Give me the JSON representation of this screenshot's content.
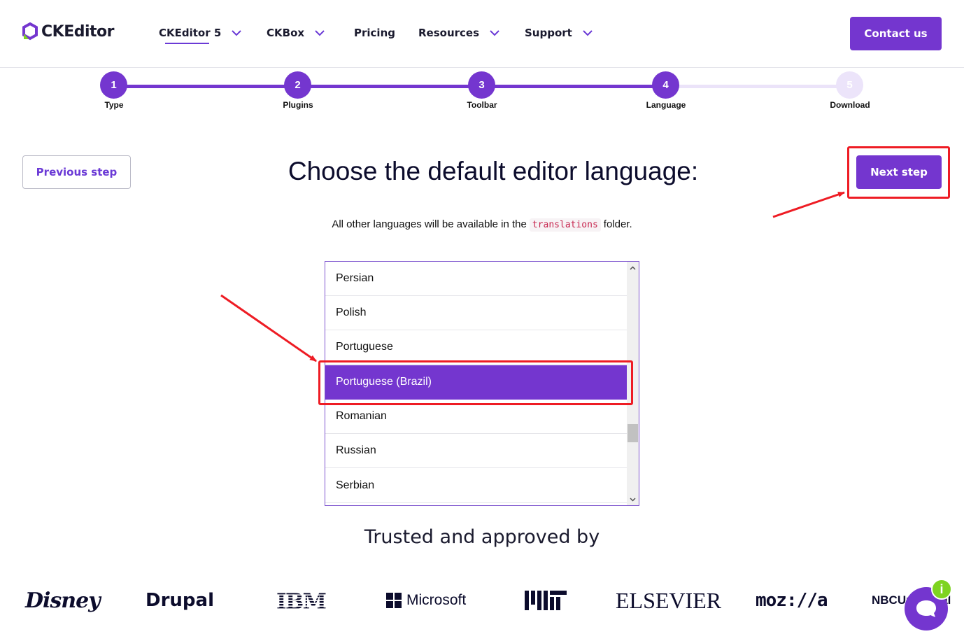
{
  "header": {
    "logo_text": "CKEditor",
    "nav": [
      {
        "label": "CKEditor 5",
        "has_dropdown": true,
        "active": true
      },
      {
        "label": "CKBox",
        "has_dropdown": true
      },
      {
        "label": "Pricing",
        "has_dropdown": false
      },
      {
        "label": "Resources",
        "has_dropdown": true
      },
      {
        "label": "Support",
        "has_dropdown": true
      }
    ],
    "contact_label": "Contact us"
  },
  "stepper": {
    "steps": [
      {
        "number": "1",
        "label": "Type",
        "state": "done"
      },
      {
        "number": "2",
        "label": "Plugins",
        "state": "done"
      },
      {
        "number": "3",
        "label": "Toolbar",
        "state": "done"
      },
      {
        "number": "4",
        "label": "Language",
        "state": "current"
      },
      {
        "number": "5",
        "label": "Download",
        "state": "todo"
      }
    ]
  },
  "actions": {
    "previous_label": "Previous step",
    "next_label": "Next step"
  },
  "main": {
    "title": "Choose the default editor language:",
    "subtitle_before": "All other languages will be available in the",
    "subtitle_code": "translations",
    "subtitle_after": "folder."
  },
  "languages": {
    "items": [
      {
        "label": "Persian",
        "selected": false
      },
      {
        "label": "Polish",
        "selected": false
      },
      {
        "label": "Portuguese",
        "selected": false
      },
      {
        "label": "Portuguese (Brazil)",
        "selected": true
      },
      {
        "label": "Romanian",
        "selected": false
      },
      {
        "label": "Russian",
        "selected": false
      },
      {
        "label": "Serbian",
        "selected": false
      }
    ]
  },
  "trusted": {
    "title": "Trusted and approved by",
    "brands": [
      "Disney",
      "Drupal",
      "IBM",
      "Microsoft",
      "MIT",
      "ELSEVIER",
      "moz://a",
      "NBCUniversal"
    ]
  },
  "chat": {
    "info_badge": "i"
  },
  "colors": {
    "accent": "#7436cf",
    "annotation": "#ee1c24",
    "stepper_inactive": "#ebe3f9",
    "info_green": "#7ed321"
  }
}
